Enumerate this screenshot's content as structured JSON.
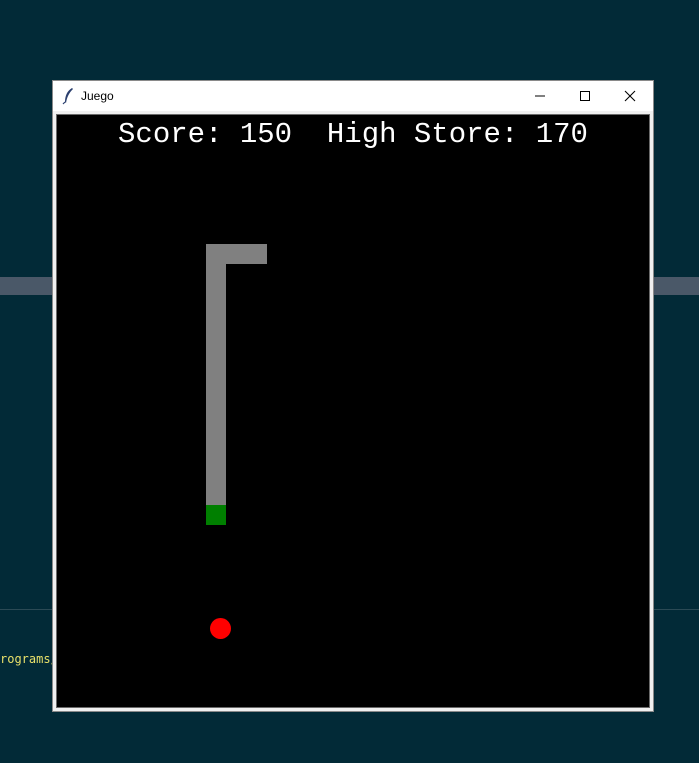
{
  "background": {
    "terminal_text": "rograms/l"
  },
  "window": {
    "title": "Juego",
    "icon": "feather-icon",
    "controls": [
      "minimize-icon",
      "maximize-icon",
      "close-icon"
    ]
  },
  "game": {
    "score_label": "Score:",
    "score": "150",
    "high_label": "High Store:",
    "high_score": "170",
    "colors": {
      "background": "#000000",
      "snake_body": "#808080",
      "snake_head": "#007f00",
      "food": "#ff0000",
      "text": "#ffffff"
    }
  }
}
